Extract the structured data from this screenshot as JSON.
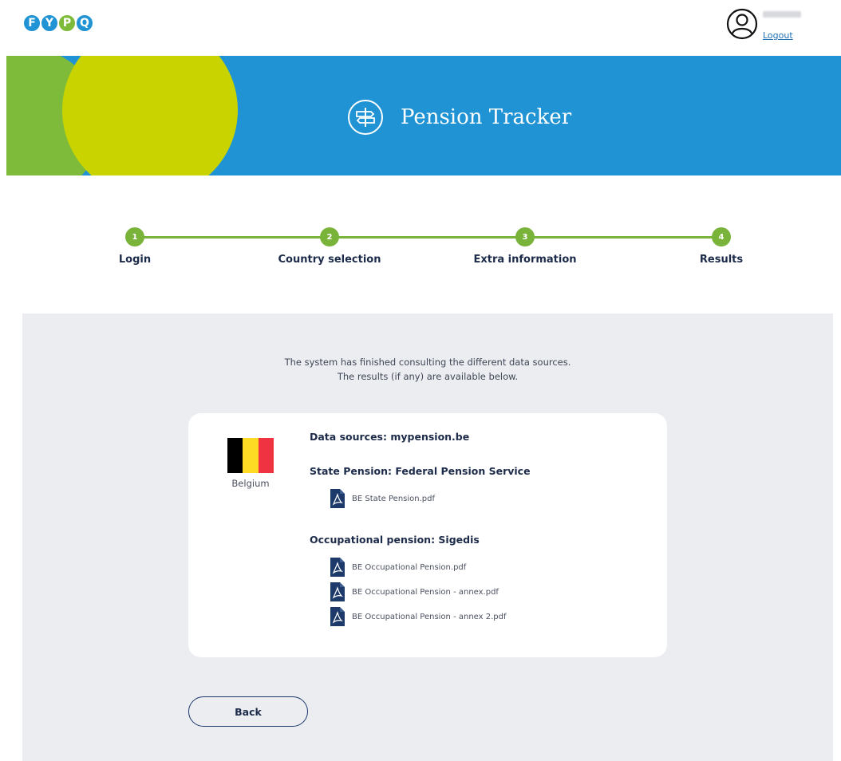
{
  "header": {
    "logo_letters": [
      {
        "char": "F",
        "color": "#1f93d3"
      },
      {
        "char": "Y",
        "color": "#1f93d3"
      },
      {
        "char": "P",
        "color": "#7fbb3b"
      },
      {
        "char": "Q",
        "color": "#1f93d3"
      }
    ],
    "logout_label": "Logout",
    "user_icon": "user-circle-icon"
  },
  "banner": {
    "title": "Pension Tracker",
    "icon": "signpost-icon",
    "colors": {
      "background": "#1f93d3",
      "circle_green": "#7fbb3b",
      "circle_lime": "#c9d300"
    }
  },
  "stepper": {
    "steps": [
      {
        "number": "1",
        "label": "Login"
      },
      {
        "number": "2",
        "label": "Country selection"
      },
      {
        "number": "3",
        "label": "Extra information"
      },
      {
        "number": "4",
        "label": "Results"
      }
    ],
    "accent": "#7ab33a"
  },
  "results": {
    "intro_line1": "The system has finished consulting the different data sources.",
    "intro_line2": "The results (if any) are available below.",
    "country": "Belgium",
    "flag_colors": [
      "#000000",
      "#fdda24",
      "#ef3340"
    ],
    "data_sources": "Data sources: mypension.be",
    "state_pension": {
      "heading": "State Pension: Federal Pension Service",
      "files": [
        "BE State Pension.pdf"
      ]
    },
    "occupational_pension": {
      "heading": "Occupational pension: Sigedis",
      "files": [
        "BE Occupational Pension.pdf",
        "BE Occupational Pension - annex.pdf",
        "BE Occupational Pension - annex 2.pdf"
      ]
    }
  },
  "footer": {
    "back_label": "Back"
  }
}
